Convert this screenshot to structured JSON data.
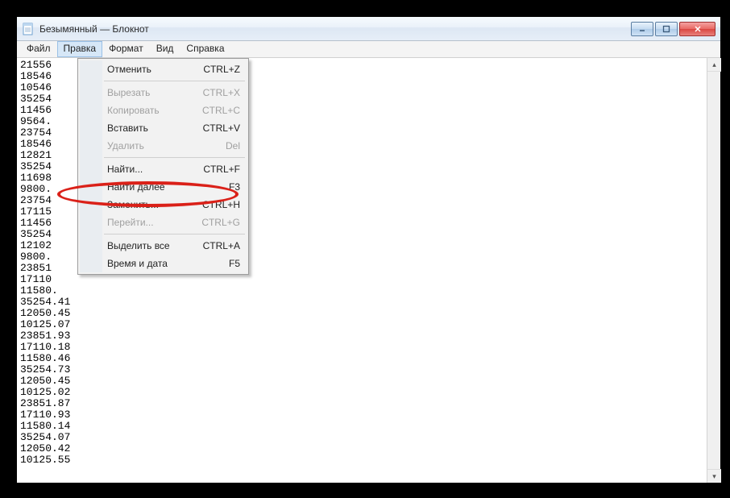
{
  "window": {
    "title": "Безымянный — Блокнот"
  },
  "menubar": {
    "items": [
      "Файл",
      "Правка",
      "Формат",
      "Вид",
      "Справка"
    ],
    "open_index": 1
  },
  "dropdown": {
    "groups": [
      [
        {
          "label": "Отменить",
          "shortcut": "CTRL+Z",
          "enabled": true
        }
      ],
      [
        {
          "label": "Вырезать",
          "shortcut": "CTRL+X",
          "enabled": false
        },
        {
          "label": "Копировать",
          "shortcut": "CTRL+C",
          "enabled": false
        },
        {
          "label": "Вставить",
          "shortcut": "CTRL+V",
          "enabled": true
        },
        {
          "label": "Удалить",
          "shortcut": "Del",
          "enabled": false
        }
      ],
      [
        {
          "label": "Найти...",
          "shortcut": "CTRL+F",
          "enabled": true
        },
        {
          "label": "Найти далее",
          "shortcut": "F3",
          "enabled": true
        },
        {
          "label": "Заменить...",
          "shortcut": "CTRL+H",
          "enabled": true,
          "highlighted": true
        },
        {
          "label": "Перейти...",
          "shortcut": "CTRL+G",
          "enabled": false
        }
      ],
      [
        {
          "label": "Выделить все",
          "shortcut": "CTRL+A",
          "enabled": true
        },
        {
          "label": "Время и дата",
          "shortcut": "F5",
          "enabled": true
        }
      ]
    ]
  },
  "text_lines": [
    "21556",
    "18546",
    "10546",
    "35254",
    "11456",
    "9564.",
    "23754",
    "18546",
    "12821",
    "35254",
    "11698",
    "9800.",
    "23754",
    "17115",
    "11456",
    "35254",
    "12102",
    "9800.",
    "23851",
    "17110",
    "11580.",
    "35254.41",
    "12050.45",
    "10125.07",
    "23851.93",
    "17110.18",
    "11580.46",
    "35254.73",
    "12050.45",
    "10125.02",
    "23851.87",
    "17110.93",
    "11580.14",
    "35254.07",
    "12050.42",
    "10125.55"
  ]
}
